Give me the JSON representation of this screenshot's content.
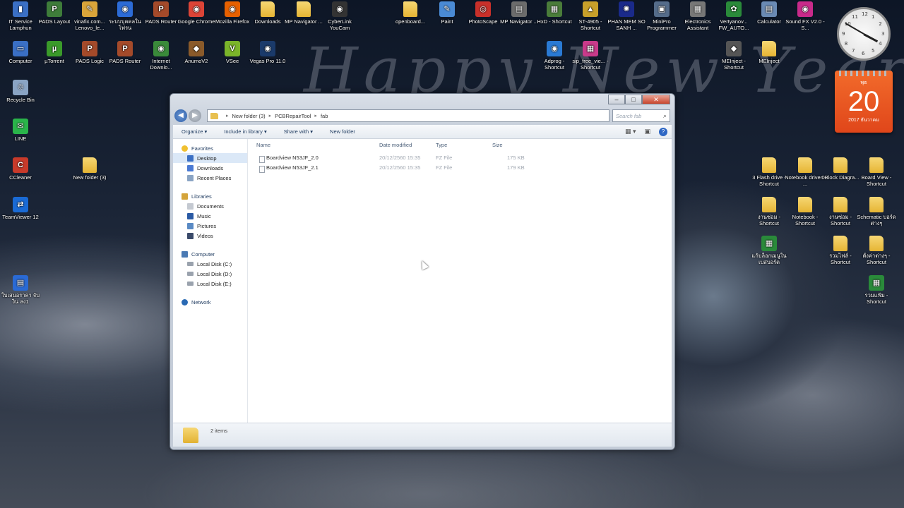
{
  "wallpaper": {
    "greeting": "Happy New Year"
  },
  "desktop_icons": [
    {
      "label": "IT Service Lamphun",
      "color": "#3a6fc4",
      "kind": "app",
      "glyph": "▮"
    },
    {
      "label": "PADS Layout",
      "color": "#3e7c3a",
      "kind": "app",
      "glyph": "P"
    },
    {
      "label": "vinafix.com... Lenovo_le...",
      "color": "#d9a43a",
      "kind": "app",
      "glyph": "✎"
    },
    {
      "label": "ระบบบุคคลใน โฟรน",
      "color": "#2c6bd6",
      "kind": "app",
      "glyph": "◉"
    },
    {
      "label": "PADS Router",
      "color": "#a44a2a",
      "kind": "app",
      "glyph": "P"
    },
    {
      "label": "Google Chrome",
      "color": "#db4437",
      "kind": "app",
      "glyph": "◉"
    },
    {
      "label": "Mozilla Firefox",
      "color": "#e66000",
      "kind": "app",
      "glyph": "◉"
    },
    {
      "label": "Downloads",
      "color": "#e6b534",
      "kind": "folder",
      "glyph": ""
    },
    {
      "label": "MP Navigator ...",
      "color": "#e6b534",
      "kind": "folder",
      "glyph": ""
    },
    {
      "label": "CyberLink YouCam",
      "color": "#333333",
      "kind": "app",
      "glyph": "◉"
    },
    {
      "label": "openboard...",
      "color": "#e6b534",
      "kind": "folder",
      "glyph": ""
    },
    {
      "label": "Paint",
      "color": "#4a8ad4",
      "kind": "app",
      "glyph": "✎"
    },
    {
      "label": "PhotoScape",
      "color": "#c8302a",
      "kind": "app",
      "glyph": "◎"
    },
    {
      "label": "MP Navigator ...",
      "color": "#6c6c6c",
      "kind": "app",
      "glyph": "▤"
    },
    {
      "label": "HxD - Shortcut",
      "color": "#4a7c3a",
      "kind": "app",
      "glyph": "▦"
    },
    {
      "label": "ST-4905 - Shortcut",
      "color": "#c8a02a",
      "kind": "app",
      "glyph": "▲"
    },
    {
      "label": "PHAN MEM SO SANH ...",
      "color": "#1a2a8a",
      "kind": "app",
      "glyph": "✺"
    },
    {
      "label": "MiniPro Programmer",
      "color": "#556c8a",
      "kind": "app",
      "glyph": "▣"
    },
    {
      "label": "Electronics Assistant",
      "color": "#777777",
      "kind": "app",
      "glyph": "▦"
    },
    {
      "label": "Vertyanov... FW_AUTO...",
      "color": "#2a8a3a",
      "kind": "app",
      "glyph": "✿"
    },
    {
      "label": "Calculator",
      "color": "#6a8ab4",
      "kind": "app",
      "glyph": "▤"
    },
    {
      "label": "Sound FX V2.0 - S...",
      "color": "#c82a8a",
      "kind": "app",
      "glyph": "◉"
    },
    {
      "label": "Computer",
      "color": "#3a6fc4",
      "kind": "app",
      "glyph": "▭"
    },
    {
      "label": "µTorrent",
      "color": "#3a9a2a",
      "kind": "app",
      "glyph": "µ"
    },
    {
      "label": "PADS Logic",
      "color": "#a44a2a",
      "kind": "app",
      "glyph": "P"
    },
    {
      "label": "PADS Router",
      "color": "#a44a2a",
      "kind": "app",
      "glyph": "P"
    },
    {
      "label": "Internet Downlo...",
      "color": "#3a8a3a",
      "kind": "app",
      "glyph": "◉"
    },
    {
      "label": "AnumoV2",
      "color": "#8a5a2a",
      "kind": "app",
      "glyph": "◆"
    },
    {
      "label": "VSee",
      "color": "#7ab42a",
      "kind": "app",
      "glyph": "V"
    },
    {
      "label": "Vegas Pro 11.0",
      "color": "#1a3a6a",
      "kind": "app",
      "glyph": "◉"
    },
    {
      "label": "Adprog - Shortcut",
      "color": "#2a7ad4",
      "kind": "app",
      "glyph": "◉"
    },
    {
      "label": "sip_free_vie... - Shortcut",
      "color": "#c83a8a",
      "kind": "app",
      "glyph": "▦"
    },
    {
      "label": "MEInject - Shortcut",
      "color": "#555555",
      "kind": "app",
      "glyph": "◆"
    },
    {
      "label": "MEInject",
      "color": "#e6b534",
      "kind": "folder",
      "glyph": ""
    },
    {
      "label": "Recycle Bin",
      "color": "#8aa4c4",
      "kind": "app",
      "glyph": "♲"
    },
    {
      "label": "LINE",
      "color": "#2ab44a",
      "kind": "app",
      "glyph": "✉"
    },
    {
      "label": "CCleaner",
      "color": "#c83a2a",
      "kind": "app",
      "glyph": "C"
    },
    {
      "label": "New folder (3)",
      "color": "#e6b534",
      "kind": "folder",
      "glyph": ""
    },
    {
      "label": "TeamViewer 12",
      "color": "#1a6ad4",
      "kind": "app",
      "glyph": "⇄"
    },
    {
      "label": "3 Flash drive - Shortcut",
      "color": "#e6b534",
      "kind": "folder",
      "glyph": ""
    },
    {
      "label": "Notebook driver - ...",
      "color": "#e6b534",
      "kind": "folder",
      "glyph": ""
    },
    {
      "label": "0Block Diagra...",
      "color": "#e6b534",
      "kind": "folder",
      "glyph": ""
    },
    {
      "label": "Board View - Shortcut",
      "color": "#e6b534",
      "kind": "folder",
      "glyph": ""
    },
    {
      "label": "งานซ่อม - Shortcut",
      "color": "#e6b534",
      "kind": "folder",
      "glyph": ""
    },
    {
      "label": "Notebook - Shortcut",
      "color": "#e6b534",
      "kind": "folder",
      "glyph": ""
    },
    {
      "label": "งานซ่อม - Shortcut",
      "color": "#e6b534",
      "kind": "folder",
      "glyph": ""
    },
    {
      "label": "Schematic บอร์ดต่างๆ",
      "color": "#e6b534",
      "kind": "folder",
      "glyph": ""
    },
    {
      "label": "แก้บล็อกเมนูใน เบสบอร์ด",
      "color": "#2a8a3a",
      "kind": "app",
      "glyph": "▦"
    },
    {
      "label": "รวมไฟล์ - Shortcut",
      "color": "#e6b534",
      "kind": "folder",
      "glyph": ""
    },
    {
      "label": "ตั้งค่าต่างๆ - Shortcut",
      "color": "#e6b534",
      "kind": "folder",
      "glyph": ""
    },
    {
      "label": "ใบเสนอราคา จับงิน ลง1",
      "color": "#2a6ad4",
      "kind": "app",
      "glyph": "▤"
    },
    {
      "label": "รวมแฟ้ม - Shortcut",
      "color": "#2a8a3a",
      "kind": "app",
      "glyph": "▦"
    }
  ],
  "clock": {
    "numbers": [
      "12",
      "1",
      "2",
      "3",
      "4",
      "5",
      "6",
      "7",
      "8",
      "9",
      "10",
      "11"
    ]
  },
  "calendar": {
    "weekday": "พุธ",
    "day": "20",
    "month_year": "2017 ธันวาคม"
  },
  "explorer": {
    "title_buttons": {
      "minimize": "–",
      "maximize": "□",
      "close": "✕"
    },
    "nav": {
      "back": "◀",
      "forward": "▶"
    },
    "path": [
      "New folder (3)",
      "PCBRepairTool",
      "fab"
    ],
    "search_placeholder": "Search fab",
    "toolbar": {
      "organize": "Organize ▾",
      "include": "Include in library ▾",
      "share": "Share with ▾",
      "new_folder": "New folder",
      "views": "▦ ▾",
      "preview": "▣",
      "help": "?"
    },
    "sidebar": {
      "favorites": {
        "header": "Favorites",
        "items": [
          "Desktop",
          "Downloads",
          "Recent Places"
        ]
      },
      "libraries": {
        "header": "Libraries",
        "items": [
          "Documents",
          "Music",
          "Pictures",
          "Videos"
        ]
      },
      "computer": {
        "header": "Computer",
        "items": [
          "Local Disk (C:)",
          "Local Disk (D:)",
          "Local Disk (E:)"
        ]
      },
      "network": {
        "header": "Network"
      }
    },
    "columns": {
      "name": "Name",
      "date": "Date modified",
      "type": "Type",
      "size": "Size"
    },
    "files": [
      {
        "name": "Boardview N53JF_2.0",
        "date": "20/12/2560 15:35",
        "type": "FZ File",
        "size": "175 KB"
      },
      {
        "name": "Boardview N53JF_2.1",
        "date": "20/12/2560 15:35",
        "type": "FZ File",
        "size": "179 KB"
      }
    ],
    "status": "2 items"
  }
}
